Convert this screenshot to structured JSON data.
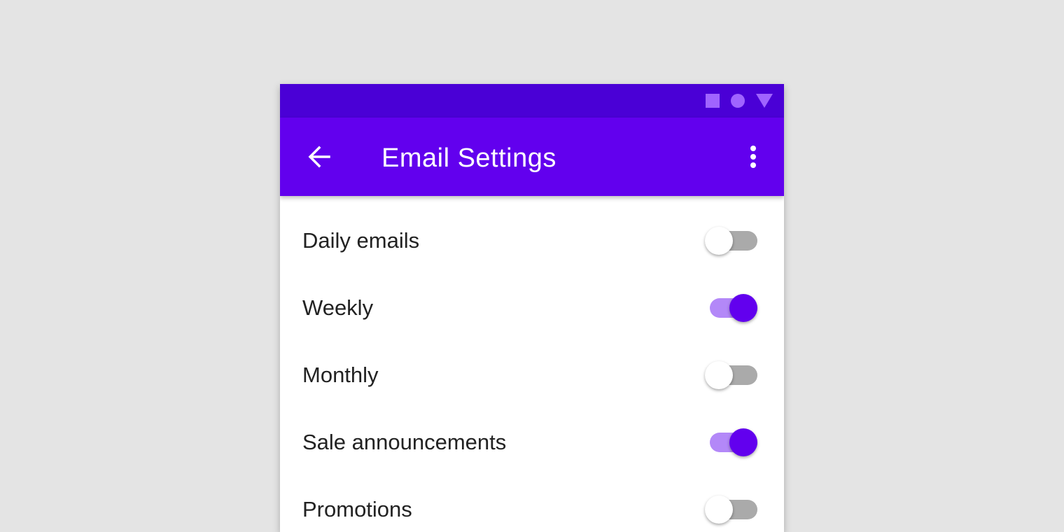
{
  "colors": {
    "status_bar": "#4a00d6",
    "app_bar": "#6200ee",
    "status_icon": "#a064ff",
    "switch_on_thumb": "#6200ee",
    "switch_on_track": "#b388f8",
    "switch_off_track": "#aaaaaa",
    "background": "#e4e4e4"
  },
  "status_bar": {
    "icons": [
      "square-icon",
      "circle-icon",
      "triangle-icon"
    ]
  },
  "app_bar": {
    "back_icon": "arrow-left-icon",
    "title": "Email Settings",
    "overflow_icon": "more-vertical-icon"
  },
  "settings": [
    {
      "label": "Daily emails",
      "enabled": false
    },
    {
      "label": "Weekly",
      "enabled": true
    },
    {
      "label": "Monthly",
      "enabled": false
    },
    {
      "label": "Sale announcements",
      "enabled": true
    },
    {
      "label": "Promotions",
      "enabled": false
    }
  ]
}
